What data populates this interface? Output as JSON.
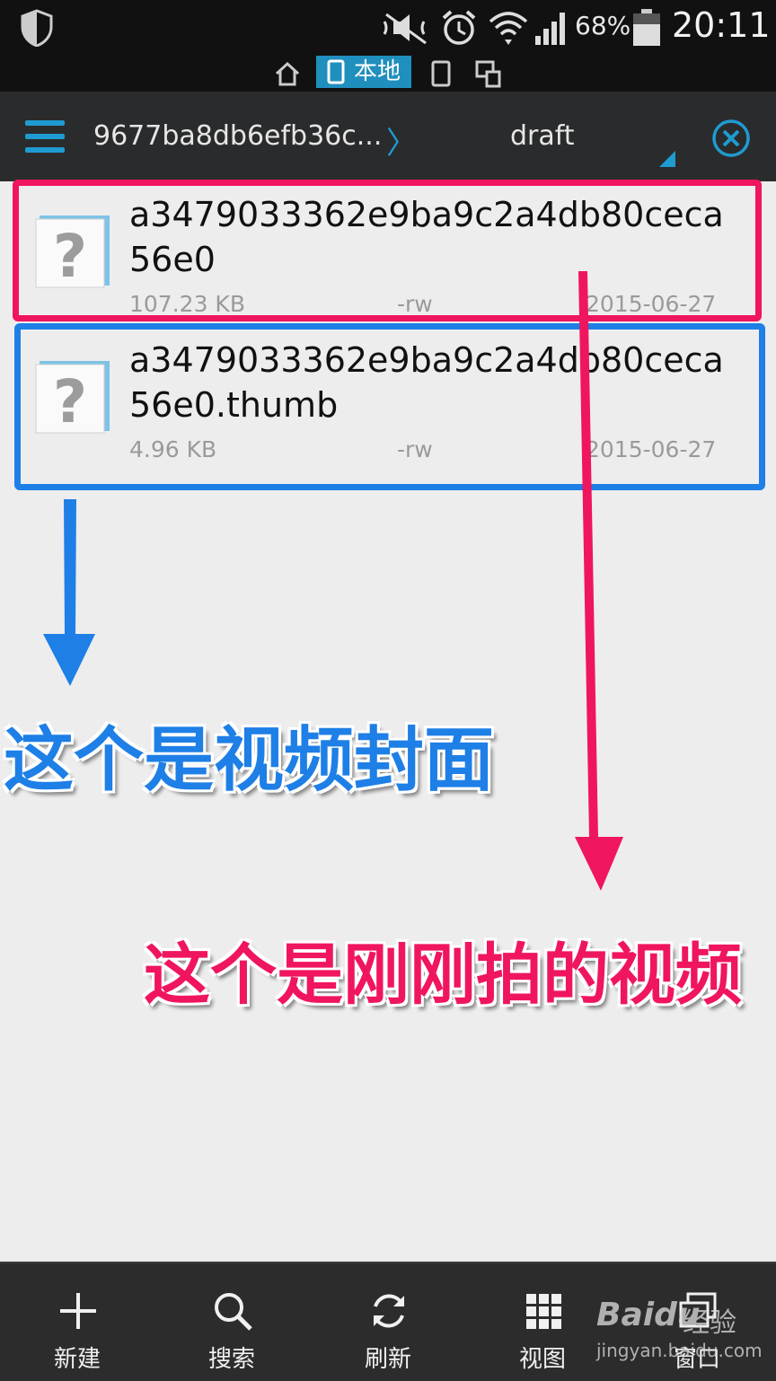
{
  "status_bar": {
    "battery_percent": "68%",
    "time": "20:11",
    "icons": [
      "shield-icon",
      "mute-icon",
      "alarm-icon",
      "wifi-icon",
      "signal-icon",
      "battery-icon"
    ]
  },
  "location_tabs": {
    "active_label": "本地",
    "icons": [
      "home-icon",
      "phone-icon",
      "tablet-icon",
      "network-devices-icon"
    ]
  },
  "header": {
    "breadcrumb_parent": "9677ba8db6efb36c...",
    "breadcrumb_separator": "〉",
    "current_folder": "draft",
    "accent_color": "#1f9bd1"
  },
  "files": [
    {
      "name": "a3479033362e9ba9c2a4db80ceca56e0",
      "size": "107.23 KB",
      "permissions": "-rw",
      "date": "2015-06-27",
      "icon": "unknown-file-icon"
    },
    {
      "name": "a3479033362e9ba9c2a4db80ceca56e0.thumb",
      "size": "4.96 KB",
      "permissions": "-rw",
      "date": "2015-06-27",
      "icon": "unknown-file-icon"
    }
  ],
  "annotations": {
    "blue_note": "这个是视频封面",
    "red_note": "这个是刚刚拍的视频",
    "blue_color": "#1e7fe6",
    "red_color": "#f0155f"
  },
  "toolbar": {
    "new_label": "新建",
    "search_label": "搜索",
    "refresh_label": "刷新",
    "view_label": "视图",
    "window_label": "窗口"
  },
  "watermark": {
    "brand": "Baidu",
    "cn": "经验",
    "url": "jingyan.baidu.com"
  }
}
